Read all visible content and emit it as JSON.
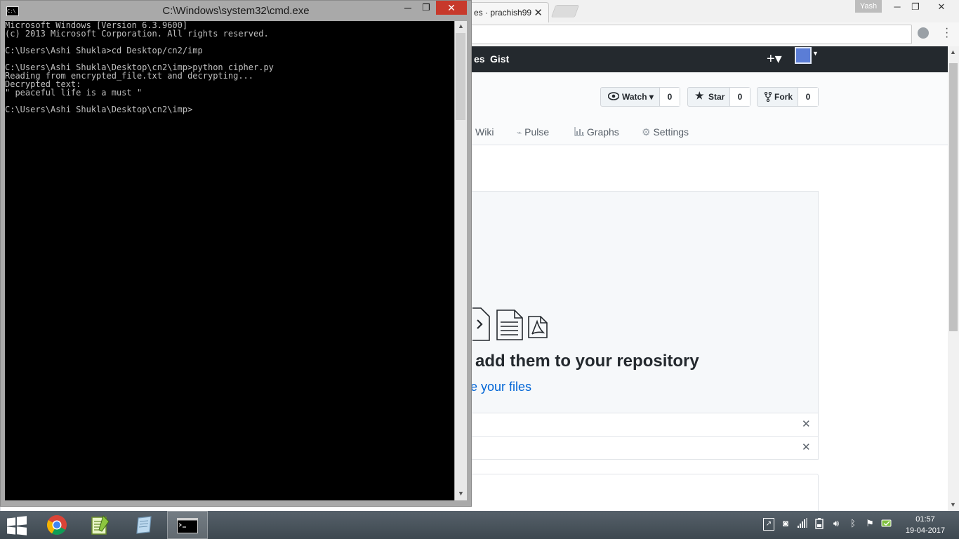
{
  "chrome": {
    "tab_title": "es · prachish99",
    "tab_close": "✕",
    "user_name": "Yash",
    "min": "─",
    "max": "❐",
    "close": "✕",
    "star": "☆"
  },
  "github": {
    "nav_partial": "es",
    "gist": "Gist",
    "plus": "+▾",
    "watch_label": "Watch ▾",
    "watch_count": "0",
    "star_label": "Star",
    "star_count": "0",
    "fork_label": "Fork",
    "fork_count": "0",
    "tabs": [
      "Wiki",
      "Pulse",
      "Graphs",
      "Settings"
    ],
    "blank_title": "add them to your repository",
    "blank_link": "e your files",
    "dismiss": "✕"
  },
  "cmd": {
    "title": "C:\\Windows\\system32\\cmd.exe",
    "min": "─",
    "max": "❐",
    "close": "✕",
    "lines": [
      "Microsoft Windows [Version 6.3.9600]",
      "(c) 2013 Microsoft Corporation. All rights reserved.",
      "",
      "C:\\Users\\Ashi Shukla>cd Desktop/cn2/imp",
      "",
      "C:\\Users\\Ashi Shukla\\Desktop\\cn2\\imp>python cipher.py",
      "Reading from encrypted_file.txt and decrypting...",
      "Decrypted text:",
      "\" peaceful life is a must \"",
      "",
      "C:\\Users\\Ashi Shukla\\Desktop\\cn2\\imp>"
    ]
  },
  "taskbar": {
    "time": "01:57",
    "date": "19-04-2017"
  },
  "colors": {
    "cmd_bg": "#000000",
    "cmd_text": "#c0c0c0",
    "github_header": "#24292e",
    "link_blue": "#0366d6",
    "close_red": "#c7392b"
  }
}
